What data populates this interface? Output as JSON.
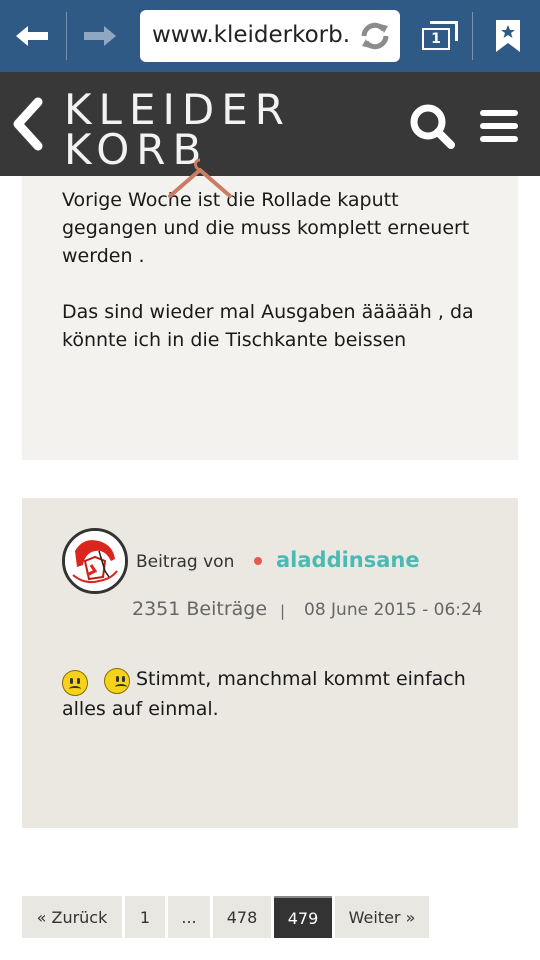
{
  "browser": {
    "url": "www.kleiderkorb.de/",
    "tab_count": "1"
  },
  "site": {
    "logo_line1": "KLEIDER",
    "logo_line2": "KORB"
  },
  "post1": {
    "paragraph1": "Vorige Woche ist die Rollade kaputt gegangen und die muss komplett erneuert werden .",
    "paragraph2": "Das sind wieder mal Ausgaben äääääh , da könnte ich in die Tischkante beissen"
  },
  "post2": {
    "by_label": "Beitrag von",
    "author": "aladdinsane",
    "post_count": "2351 Beiträge",
    "separator": "|",
    "date": "08 June 2015 - 06:24",
    "text": "Stimmt, manchmal kommt einfach alles auf einmal."
  },
  "pagination": {
    "prev": "« Zurück",
    "pages": [
      "1",
      "...",
      "478",
      "479"
    ],
    "next": "Weiter »",
    "current": "479"
  },
  "colors": {
    "browser_bar": "#2f5a86",
    "site_header": "#383838",
    "author": "#4bbab4",
    "online": "#e9574f"
  }
}
